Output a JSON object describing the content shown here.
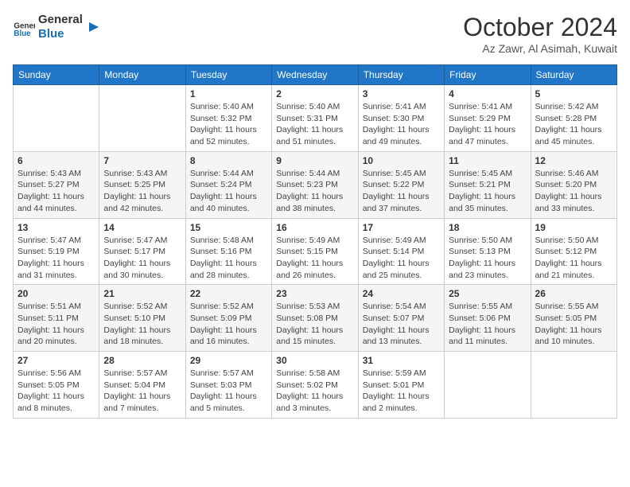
{
  "logo": {
    "text_general": "General",
    "text_blue": "Blue"
  },
  "header": {
    "month": "October 2024",
    "location": "Az Zawr, Al Asimah, Kuwait"
  },
  "days_of_week": [
    "Sunday",
    "Monday",
    "Tuesday",
    "Wednesday",
    "Thursday",
    "Friday",
    "Saturday"
  ],
  "weeks": [
    [
      {
        "day": null
      },
      {
        "day": null
      },
      {
        "day": "1",
        "sunrise": "Sunrise: 5:40 AM",
        "sunset": "Sunset: 5:32 PM",
        "daylight": "Daylight: 11 hours and 52 minutes."
      },
      {
        "day": "2",
        "sunrise": "Sunrise: 5:40 AM",
        "sunset": "Sunset: 5:31 PM",
        "daylight": "Daylight: 11 hours and 51 minutes."
      },
      {
        "day": "3",
        "sunrise": "Sunrise: 5:41 AM",
        "sunset": "Sunset: 5:30 PM",
        "daylight": "Daylight: 11 hours and 49 minutes."
      },
      {
        "day": "4",
        "sunrise": "Sunrise: 5:41 AM",
        "sunset": "Sunset: 5:29 PM",
        "daylight": "Daylight: 11 hours and 47 minutes."
      },
      {
        "day": "5",
        "sunrise": "Sunrise: 5:42 AM",
        "sunset": "Sunset: 5:28 PM",
        "daylight": "Daylight: 11 hours and 45 minutes."
      }
    ],
    [
      {
        "day": "6",
        "sunrise": "Sunrise: 5:43 AM",
        "sunset": "Sunset: 5:27 PM",
        "daylight": "Daylight: 11 hours and 44 minutes."
      },
      {
        "day": "7",
        "sunrise": "Sunrise: 5:43 AM",
        "sunset": "Sunset: 5:25 PM",
        "daylight": "Daylight: 11 hours and 42 minutes."
      },
      {
        "day": "8",
        "sunrise": "Sunrise: 5:44 AM",
        "sunset": "Sunset: 5:24 PM",
        "daylight": "Daylight: 11 hours and 40 minutes."
      },
      {
        "day": "9",
        "sunrise": "Sunrise: 5:44 AM",
        "sunset": "Sunset: 5:23 PM",
        "daylight": "Daylight: 11 hours and 38 minutes."
      },
      {
        "day": "10",
        "sunrise": "Sunrise: 5:45 AM",
        "sunset": "Sunset: 5:22 PM",
        "daylight": "Daylight: 11 hours and 37 minutes."
      },
      {
        "day": "11",
        "sunrise": "Sunrise: 5:45 AM",
        "sunset": "Sunset: 5:21 PM",
        "daylight": "Daylight: 11 hours and 35 minutes."
      },
      {
        "day": "12",
        "sunrise": "Sunrise: 5:46 AM",
        "sunset": "Sunset: 5:20 PM",
        "daylight": "Daylight: 11 hours and 33 minutes."
      }
    ],
    [
      {
        "day": "13",
        "sunrise": "Sunrise: 5:47 AM",
        "sunset": "Sunset: 5:19 PM",
        "daylight": "Daylight: 11 hours and 31 minutes."
      },
      {
        "day": "14",
        "sunrise": "Sunrise: 5:47 AM",
        "sunset": "Sunset: 5:17 PM",
        "daylight": "Daylight: 11 hours and 30 minutes."
      },
      {
        "day": "15",
        "sunrise": "Sunrise: 5:48 AM",
        "sunset": "Sunset: 5:16 PM",
        "daylight": "Daylight: 11 hours and 28 minutes."
      },
      {
        "day": "16",
        "sunrise": "Sunrise: 5:49 AM",
        "sunset": "Sunset: 5:15 PM",
        "daylight": "Daylight: 11 hours and 26 minutes."
      },
      {
        "day": "17",
        "sunrise": "Sunrise: 5:49 AM",
        "sunset": "Sunset: 5:14 PM",
        "daylight": "Daylight: 11 hours and 25 minutes."
      },
      {
        "day": "18",
        "sunrise": "Sunrise: 5:50 AM",
        "sunset": "Sunset: 5:13 PM",
        "daylight": "Daylight: 11 hours and 23 minutes."
      },
      {
        "day": "19",
        "sunrise": "Sunrise: 5:50 AM",
        "sunset": "Sunset: 5:12 PM",
        "daylight": "Daylight: 11 hours and 21 minutes."
      }
    ],
    [
      {
        "day": "20",
        "sunrise": "Sunrise: 5:51 AM",
        "sunset": "Sunset: 5:11 PM",
        "daylight": "Daylight: 11 hours and 20 minutes."
      },
      {
        "day": "21",
        "sunrise": "Sunrise: 5:52 AM",
        "sunset": "Sunset: 5:10 PM",
        "daylight": "Daylight: 11 hours and 18 minutes."
      },
      {
        "day": "22",
        "sunrise": "Sunrise: 5:52 AM",
        "sunset": "Sunset: 5:09 PM",
        "daylight": "Daylight: 11 hours and 16 minutes."
      },
      {
        "day": "23",
        "sunrise": "Sunrise: 5:53 AM",
        "sunset": "Sunset: 5:08 PM",
        "daylight": "Daylight: 11 hours and 15 minutes."
      },
      {
        "day": "24",
        "sunrise": "Sunrise: 5:54 AM",
        "sunset": "Sunset: 5:07 PM",
        "daylight": "Daylight: 11 hours and 13 minutes."
      },
      {
        "day": "25",
        "sunrise": "Sunrise: 5:55 AM",
        "sunset": "Sunset: 5:06 PM",
        "daylight": "Daylight: 11 hours and 11 minutes."
      },
      {
        "day": "26",
        "sunrise": "Sunrise: 5:55 AM",
        "sunset": "Sunset: 5:05 PM",
        "daylight": "Daylight: 11 hours and 10 minutes."
      }
    ],
    [
      {
        "day": "27",
        "sunrise": "Sunrise: 5:56 AM",
        "sunset": "Sunset: 5:05 PM",
        "daylight": "Daylight: 11 hours and 8 minutes."
      },
      {
        "day": "28",
        "sunrise": "Sunrise: 5:57 AM",
        "sunset": "Sunset: 5:04 PM",
        "daylight": "Daylight: 11 hours and 7 minutes."
      },
      {
        "day": "29",
        "sunrise": "Sunrise: 5:57 AM",
        "sunset": "Sunset: 5:03 PM",
        "daylight": "Daylight: 11 hours and 5 minutes."
      },
      {
        "day": "30",
        "sunrise": "Sunrise: 5:58 AM",
        "sunset": "Sunset: 5:02 PM",
        "daylight": "Daylight: 11 hours and 3 minutes."
      },
      {
        "day": "31",
        "sunrise": "Sunrise: 5:59 AM",
        "sunset": "Sunset: 5:01 PM",
        "daylight": "Daylight: 11 hours and 2 minutes."
      },
      {
        "day": null
      },
      {
        "day": null
      }
    ]
  ]
}
